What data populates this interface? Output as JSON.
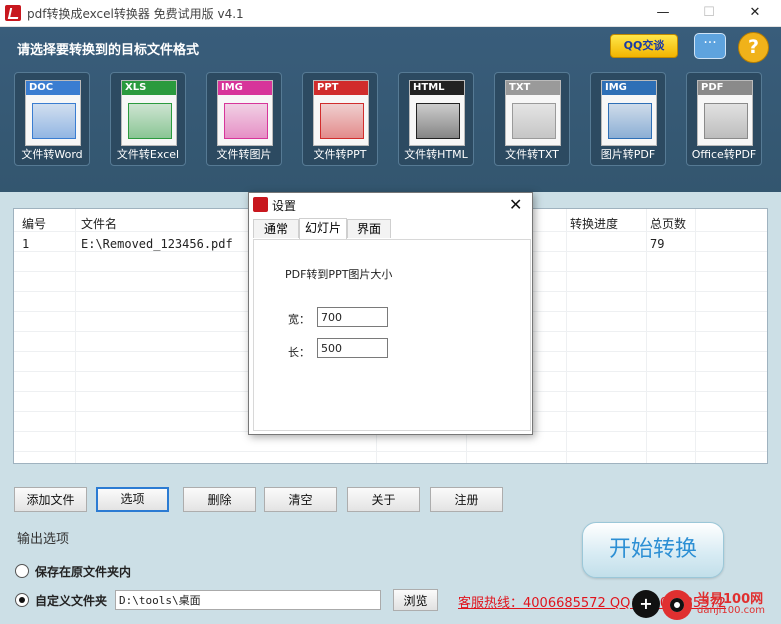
{
  "window": {
    "title": "pdf转换成excel转换器 免费试用版 v4.1",
    "min": "—",
    "max": "☐",
    "close": "✕"
  },
  "header": {
    "title": "请选择要转换到的目标文件格式",
    "qq_label": "QQ交谈",
    "chat_icon": "speech-bubble",
    "help_label": "?"
  },
  "tools": [
    {
      "tag": "DOC",
      "label": "文件转Word",
      "color": "#3a7dd1"
    },
    {
      "tag": "XLS",
      "label": "文件转Excel",
      "color": "#2b9a3e"
    },
    {
      "tag": "IMG",
      "label": "文件转图片",
      "color": "#d7359a"
    },
    {
      "tag": "PPT",
      "label": "文件转PPT",
      "color": "#d12c2c"
    },
    {
      "tag": "HTML",
      "label": "文件转HTML",
      "color": "#222222"
    },
    {
      "tag": "TXT",
      "label": "文件转TXT",
      "color": "#9a9a9a"
    },
    {
      "tag": "IMG",
      "label": "图片转PDF",
      "color": "#2e6fb6"
    },
    {
      "tag": "PDF",
      "label": "Office转PDF",
      "color": "#8a8a8a"
    }
  ],
  "grid": {
    "headers": {
      "no": "编号",
      "filename": "文件名",
      "progress": "转换进度",
      "pages": "总页数"
    },
    "rows": [
      {
        "no": "1",
        "filename": "E:\\Removed_123456.pdf",
        "progress": "",
        "pages": "79"
      }
    ]
  },
  "buttons": {
    "add_file": "添加文件",
    "options": "选项",
    "delete": "删除",
    "clear": "清空",
    "about": "关于",
    "register": "注册"
  },
  "output": {
    "title": "输出选项",
    "keep_original": "保存在原文件夹内",
    "custom_folder": "自定义文件夹",
    "custom_selected": true,
    "path": "D:\\tools\\桌面",
    "browse": "浏览"
  },
  "hotline": "客服热线：4006685572 QQ：4006685572",
  "start_button": "开始转换",
  "watermark": {
    "text": "当易100网",
    "sub": "danji100.com"
  },
  "dialog": {
    "title": "设置",
    "close": "✕",
    "tabs": [
      "通常",
      "幻灯片",
      "界面"
    ],
    "active_tab": 1,
    "section_label": "PDF转到PPT图片大小",
    "width_label": "宽：",
    "width_value": "700",
    "height_label": "长：",
    "height_value": "500"
  }
}
